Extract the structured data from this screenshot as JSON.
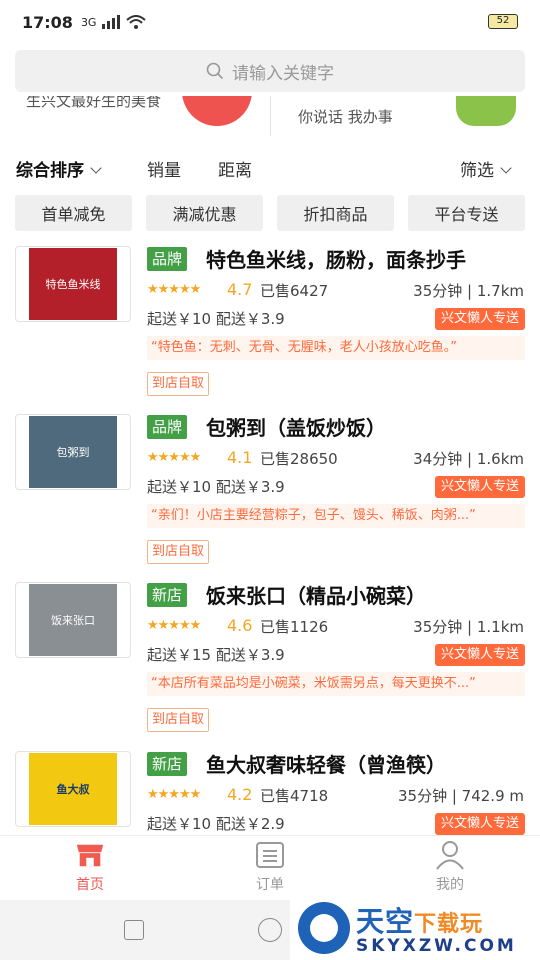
{
  "status_bar": {
    "time": "17:08",
    "network": "3G",
    "battery": "52"
  },
  "search": {
    "placeholder": "请输入关键字"
  },
  "banner": {
    "left_text": "生兴文最好生的美食",
    "right_text": "你说话 我办事"
  },
  "sort_bar": {
    "composite": "综合排序",
    "sales": "销量",
    "distance": "距离",
    "filter": "筛选"
  },
  "filter_chips": [
    "首单减免",
    "满减优惠",
    "折扣商品",
    "平台专送"
  ],
  "stores": [
    {
      "tag": "品牌",
      "name": "特色鱼米线，肠粉，面条抄手",
      "rating": "4.7",
      "sold": "已售6427",
      "time_distance": "35分钟 | 1.7km",
      "fees": "起送￥10  配送￥3.9",
      "delivery_badge": "兴文懒人专送",
      "promo": "“特色鱼：无刺、无骨、无腥味，老人小孩放心吃鱼。”",
      "pickup": "到店自取",
      "thumb_text": "特色鱼米线"
    },
    {
      "tag": "品牌",
      "name": "包粥到（盖饭炒饭）",
      "rating": "4.1",
      "sold": "已售28650",
      "time_distance": "34分钟 | 1.6km",
      "fees": "起送￥10  配送￥3.9",
      "delivery_badge": "兴文懒人专送",
      "promo": "“亲们！小店主要经营粽子，包子、馒头、稀饭、肉粥...”",
      "pickup": "到店自取",
      "thumb_text": "包粥到"
    },
    {
      "tag": "新店",
      "name": "饭来张口（精品小碗菜）",
      "rating": "4.6",
      "sold": "已售1126",
      "time_distance": "35分钟 | 1.1km",
      "fees": "起送￥15  配送￥3.9",
      "delivery_badge": "兴文懒人专送",
      "promo": "“本店所有菜品均是小碗菜，米饭需另点，每天更换不...”",
      "pickup": "到店自取",
      "thumb_text": "饭来张口"
    },
    {
      "tag": "新店",
      "name": "鱼大叔奢味轻餐（曾渔筷）",
      "rating": "4.2",
      "sold": "已售4718",
      "time_distance": "35分钟 | 742.9 m",
      "fees": "起送￥10  配送￥2.9",
      "delivery_badge": "兴文懒人专送",
      "promo": "",
      "pickup": "",
      "thumb_text": "鱼大叔"
    }
  ],
  "tab_bar": {
    "home": "首页",
    "orders": "订单",
    "mine": "我的"
  },
  "watermark": {
    "title_blue": "天空",
    "title_orange": "下载玩",
    "sub": "SKYXZW.COM"
  },
  "colors": {
    "accent": "#f05a4f",
    "tag_green": "#43a047",
    "orange": "#ff6a3d",
    "star": "#f5a623"
  }
}
